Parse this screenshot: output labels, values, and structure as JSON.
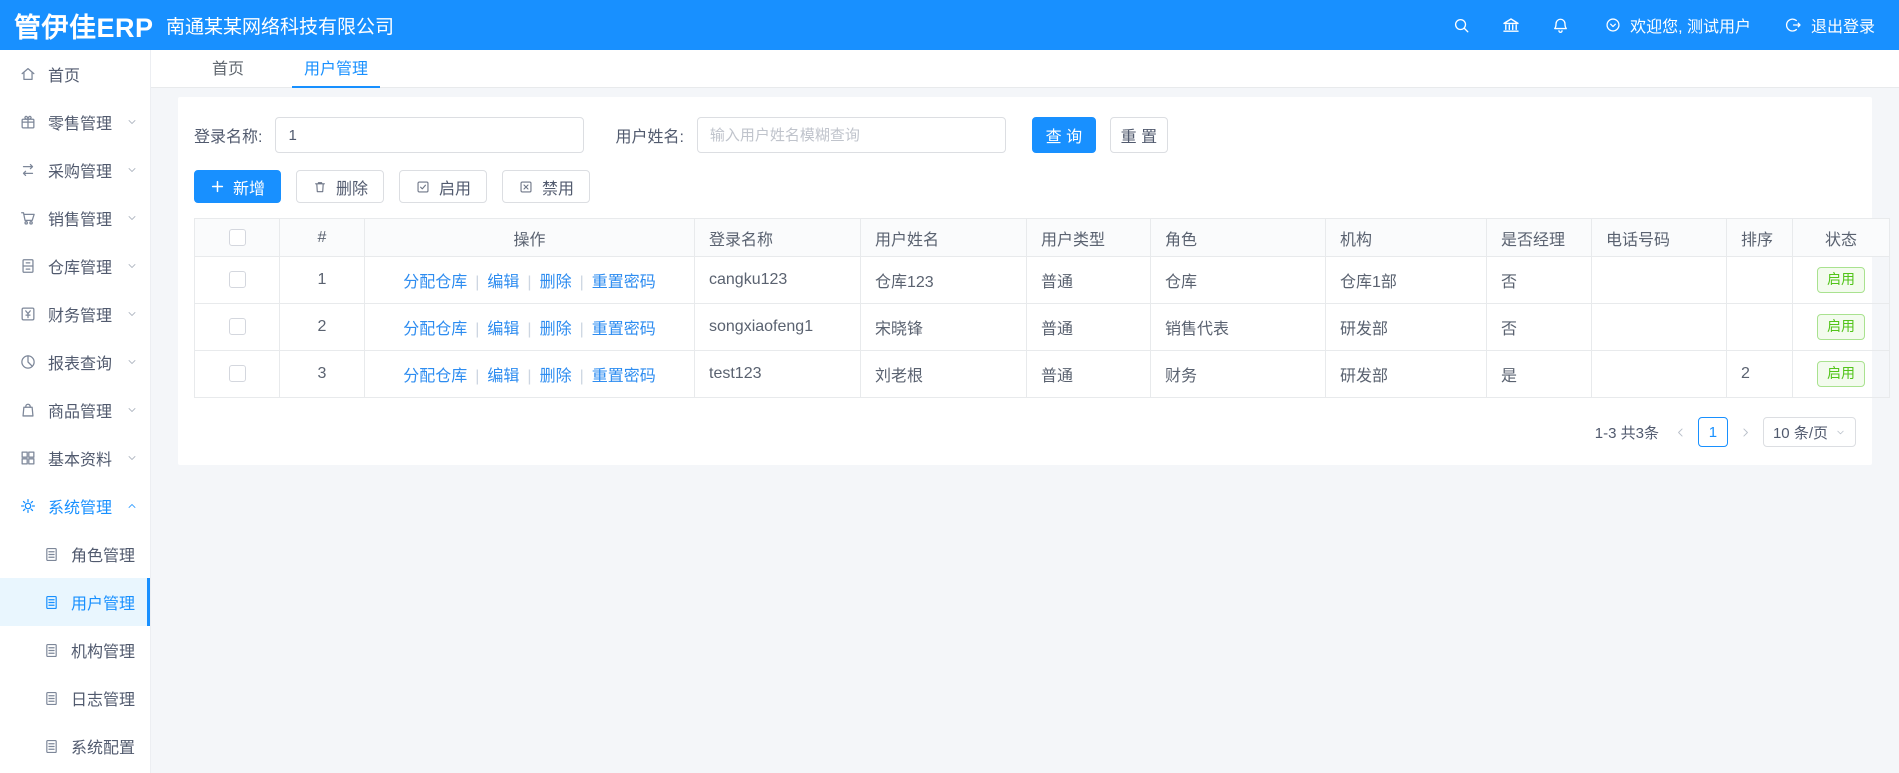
{
  "app": {
    "logo": "管伊佳ERP",
    "company": "南通某某网络科技有限公司",
    "welcome": "欢迎您, 测试用户",
    "logout": "退出登录"
  },
  "colors": {
    "primary": "#1890ff",
    "active_item_bg": "#e9f6fe",
    "status_green": "#52c41a"
  },
  "sidebar": {
    "items": [
      {
        "label": "首页"
      },
      {
        "label": "零售管理"
      },
      {
        "label": "采购管理"
      },
      {
        "label": "销售管理"
      },
      {
        "label": "仓库管理"
      },
      {
        "label": "财务管理"
      },
      {
        "label": "报表查询"
      },
      {
        "label": "商品管理"
      },
      {
        "label": "基本资料"
      },
      {
        "label": "系统管理"
      }
    ],
    "system_children": [
      "角色管理",
      "用户管理",
      "机构管理",
      "日志管理",
      "系统配置"
    ],
    "active_child": "用户管理"
  },
  "tabs": [
    {
      "label": "首页"
    },
    {
      "label": "用户管理"
    }
  ],
  "search": {
    "login_label": "登录名称:",
    "login_value": "1",
    "name_label": "用户姓名:",
    "name_placeholder": "输入用户姓名模糊查询",
    "query_label": "查 询",
    "reset_label": "重 置"
  },
  "toolbar": {
    "add_label": "新增",
    "delete_label": "删除",
    "enable_label": "启用",
    "disable_label": "禁用"
  },
  "table": {
    "headers": [
      "#",
      "操作",
      "登录名称",
      "用户姓名",
      "用户类型",
      "角色",
      "机构",
      "是否经理",
      "电话号码",
      "排序",
      "状态"
    ],
    "op_links": [
      "分配仓库",
      "编辑",
      "删除",
      "重置密码"
    ],
    "rows": [
      {
        "index": "1",
        "login": "cangku123",
        "name": "仓库123",
        "type": "普通",
        "role": "仓库",
        "org": "仓库1部",
        "manager": "否",
        "phone": "",
        "sort": "",
        "status": "启用"
      },
      {
        "index": "2",
        "login": "songxiaofeng1",
        "name": "宋晓锋",
        "type": "普通",
        "role": "销售代表",
        "org": "研发部",
        "manager": "否",
        "phone": "",
        "sort": "",
        "status": "启用"
      },
      {
        "index": "3",
        "login": "test123",
        "name": "刘老根",
        "type": "普通",
        "role": "财务",
        "org": "研发部",
        "manager": "是",
        "phone": "",
        "sort": "2",
        "status": "启用"
      }
    ]
  },
  "pagination": {
    "total_text": "1-3 共3条",
    "current_page": "1",
    "page_size": "10 条/页"
  }
}
